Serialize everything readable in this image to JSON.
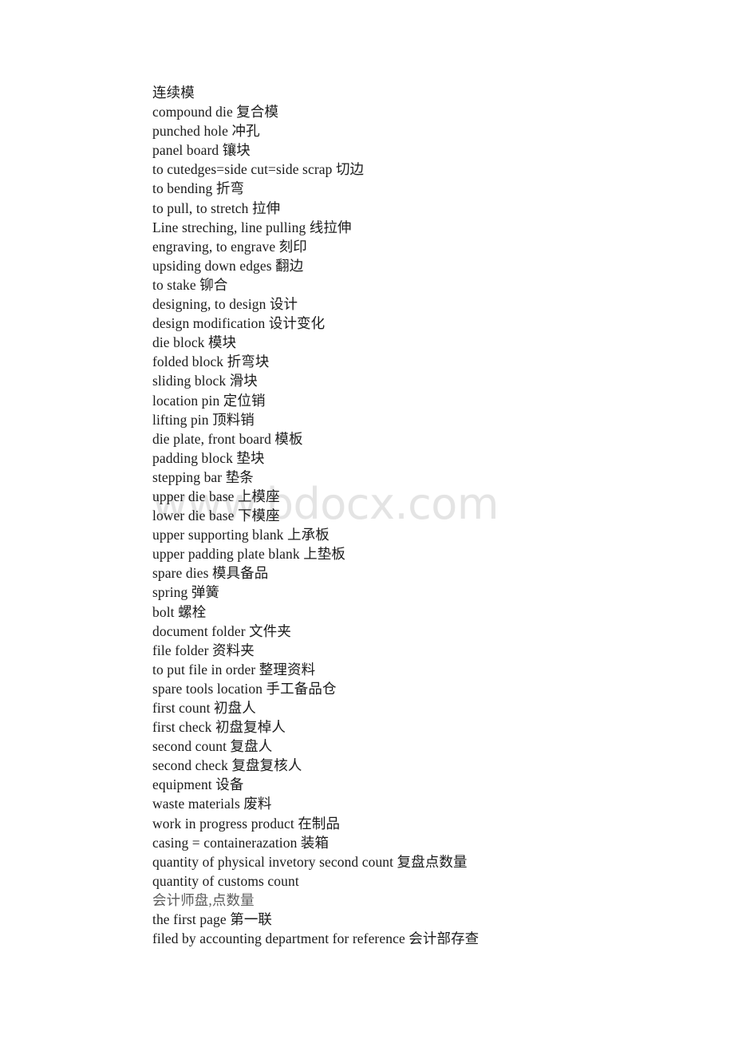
{
  "document": {
    "type": "glossary-page",
    "page_background": "#ffffff",
    "text_color": "#1b1b1b",
    "faint_text_color": "#5d5d5d",
    "lines": [
      {
        "text": "连续模",
        "style": "normal"
      },
      {
        "text": "compound die 复合模",
        "style": "normal"
      },
      {
        "text": "punched hole 冲孔",
        "style": "normal"
      },
      {
        "text": "panel board 镶块",
        "style": "normal"
      },
      {
        "text": "to cutedges=side cut=side scrap 切边",
        "style": "normal"
      },
      {
        "text": "to bending 折弯",
        "style": "normal"
      },
      {
        "text": "to pull, to stretch 拉伸",
        "style": "normal"
      },
      {
        "text": "Line streching, line pulling 线拉伸",
        "style": "normal"
      },
      {
        "text": "engraving, to engrave 刻印",
        "style": "normal"
      },
      {
        "text": "upsiding down edges 翻边",
        "style": "normal"
      },
      {
        "text": "to stake 铆合",
        "style": "normal"
      },
      {
        "text": "designing, to design 设计",
        "style": "normal"
      },
      {
        "text": "design modification 设计变化",
        "style": "normal"
      },
      {
        "text": "die block 模块",
        "style": "normal"
      },
      {
        "text": "folded block 折弯块",
        "style": "normal"
      },
      {
        "text": "sliding block 滑块",
        "style": "normal"
      },
      {
        "text": "location pin 定位销",
        "style": "normal"
      },
      {
        "text": "lifting pin 顶料销",
        "style": "normal"
      },
      {
        "text": "die plate, front board 模板",
        "style": "normal"
      },
      {
        "text": "padding block 垫块",
        "style": "normal"
      },
      {
        "text": "stepping bar 垫条",
        "style": "normal"
      },
      {
        "text": "upper die base 上模座",
        "style": "normal"
      },
      {
        "text": "lower die base 下模座",
        "style": "normal"
      },
      {
        "text": "upper supporting blank 上承板",
        "style": "normal"
      },
      {
        "text": "upper padding plate blank 上垫板",
        "style": "normal"
      },
      {
        "text": "spare dies 模具备品",
        "style": "normal"
      },
      {
        "text": "spring 弹簧",
        "style": "normal"
      },
      {
        "text": "bolt 螺栓",
        "style": "normal"
      },
      {
        "text": "document folder 文件夹",
        "style": "normal"
      },
      {
        "text": "file folder 资料夹",
        "style": "normal"
      },
      {
        "text": "to put file in order 整理资料",
        "style": "normal"
      },
      {
        "text": "spare tools location 手工备品仓",
        "style": "normal"
      },
      {
        "text": "first count 初盘人",
        "style": "normal"
      },
      {
        "text": "first check 初盘复棹人",
        "style": "normal"
      },
      {
        "text": "second count 复盘人",
        "style": "normal"
      },
      {
        "text": "second check 复盘复核人",
        "style": "normal"
      },
      {
        "text": "equipment 设备",
        "style": "normal"
      },
      {
        "text": "waste materials 废料",
        "style": "normal"
      },
      {
        "text": "work in progress product 在制品",
        "style": "normal"
      },
      {
        "text": "casing = containerazation 装箱",
        "style": "normal"
      },
      {
        "text": "quantity of physical invetory second count 复盘点数量",
        "style": "normal"
      },
      {
        "text": "quantity of customs count",
        "style": "normal"
      },
      {
        "text": "会计师盘,点数量",
        "style": "faint"
      },
      {
        "text": "the first page 第一联",
        "style": "normal"
      },
      {
        "text": "filed by accounting department for reference 会计部存查",
        "style": "normal"
      }
    ]
  },
  "watermark": {
    "text": "www.bdocx.com",
    "color": "#e4e4e4"
  }
}
